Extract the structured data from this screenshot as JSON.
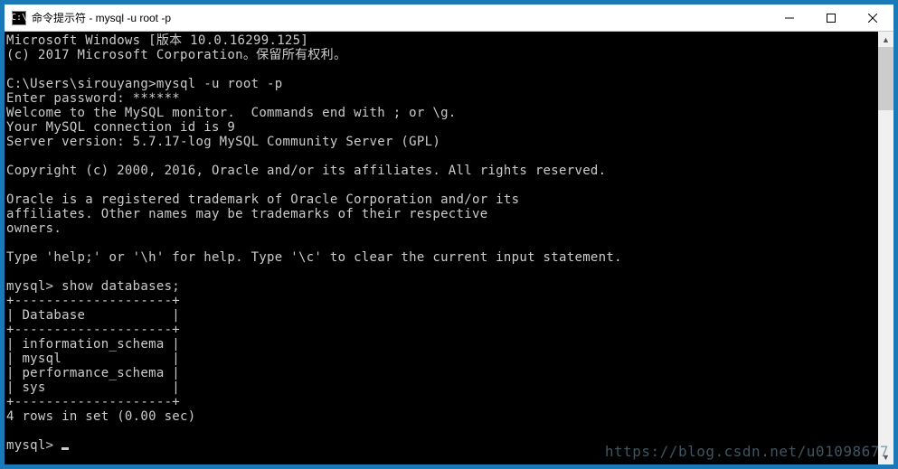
{
  "titlebar": {
    "icon_text": "C:\\",
    "title": "命令提示符 - mysql  -u root -p"
  },
  "terminal": {
    "lines": [
      "Microsoft Windows [版本 10.0.16299.125]",
      "(c) 2017 Microsoft Corporation。保留所有权利。",
      "",
      "C:\\Users\\sirouyang>mysql -u root -p",
      "Enter password: ******",
      "Welcome to the MySQL monitor.  Commands end with ; or \\g.",
      "Your MySQL connection id is 9",
      "Server version: 5.7.17-log MySQL Community Server (GPL)",
      "",
      "Copyright (c) 2000, 2016, Oracle and/or its affiliates. All rights reserved.",
      "",
      "Oracle is a registered trademark of Oracle Corporation and/or its",
      "affiliates. Other names may be trademarks of their respective",
      "owners.",
      "",
      "Type 'help;' or '\\h' for help. Type '\\c' to clear the current input statement.",
      "",
      "mysql> show databases;",
      "+--------------------+",
      "| Database           |",
      "+--------------------+",
      "| information_schema |",
      "| mysql              |",
      "| performance_schema |",
      "| sys                |",
      "+--------------------+",
      "4 rows in set (0.00 sec)",
      "",
      "mysql> "
    ]
  },
  "watermark": "https://blog.csdn.net/u01098677"
}
